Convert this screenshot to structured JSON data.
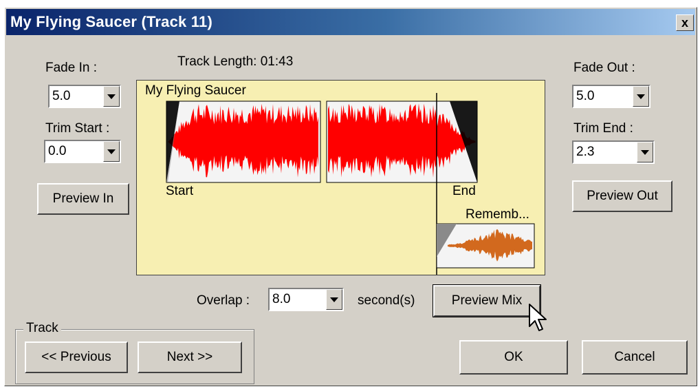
{
  "window": {
    "title": "My Flying Saucer (Track 11)",
    "close_glyph": "x"
  },
  "track_length": {
    "label": "Track Length: 01:43"
  },
  "fade_in": {
    "label": "Fade In :",
    "value": "5.0"
  },
  "trim_start": {
    "label": "Trim Start :",
    "value": "0.0"
  },
  "fade_out": {
    "label": "Fade Out :",
    "value": "5.0"
  },
  "trim_end": {
    "label": "Trim End :",
    "value": "2.3"
  },
  "buttons": {
    "preview_in": "Preview In",
    "preview_out": "Preview Out",
    "preview_mix": "Preview Mix",
    "previous": "<< Previous",
    "next": "Next >>",
    "ok": "OK",
    "cancel": "Cancel"
  },
  "waveform": {
    "track_name": "My Flying Saucer",
    "start_label": "Start",
    "end_label": "End",
    "next_track_name": "Rememb...",
    "colors": {
      "panel": "#f7efb2",
      "main_wave": "#ff0000",
      "next_wave": "#d2691e",
      "fade": "#000000"
    }
  },
  "overlap": {
    "label": "Overlap :",
    "value": "8.0",
    "unit": "second(s)"
  },
  "track_group": {
    "label": "Track"
  },
  "icons": {
    "cursor": "mouse-pointer-icon",
    "dropdown": "chevron-down-icon",
    "close": "close-icon"
  }
}
